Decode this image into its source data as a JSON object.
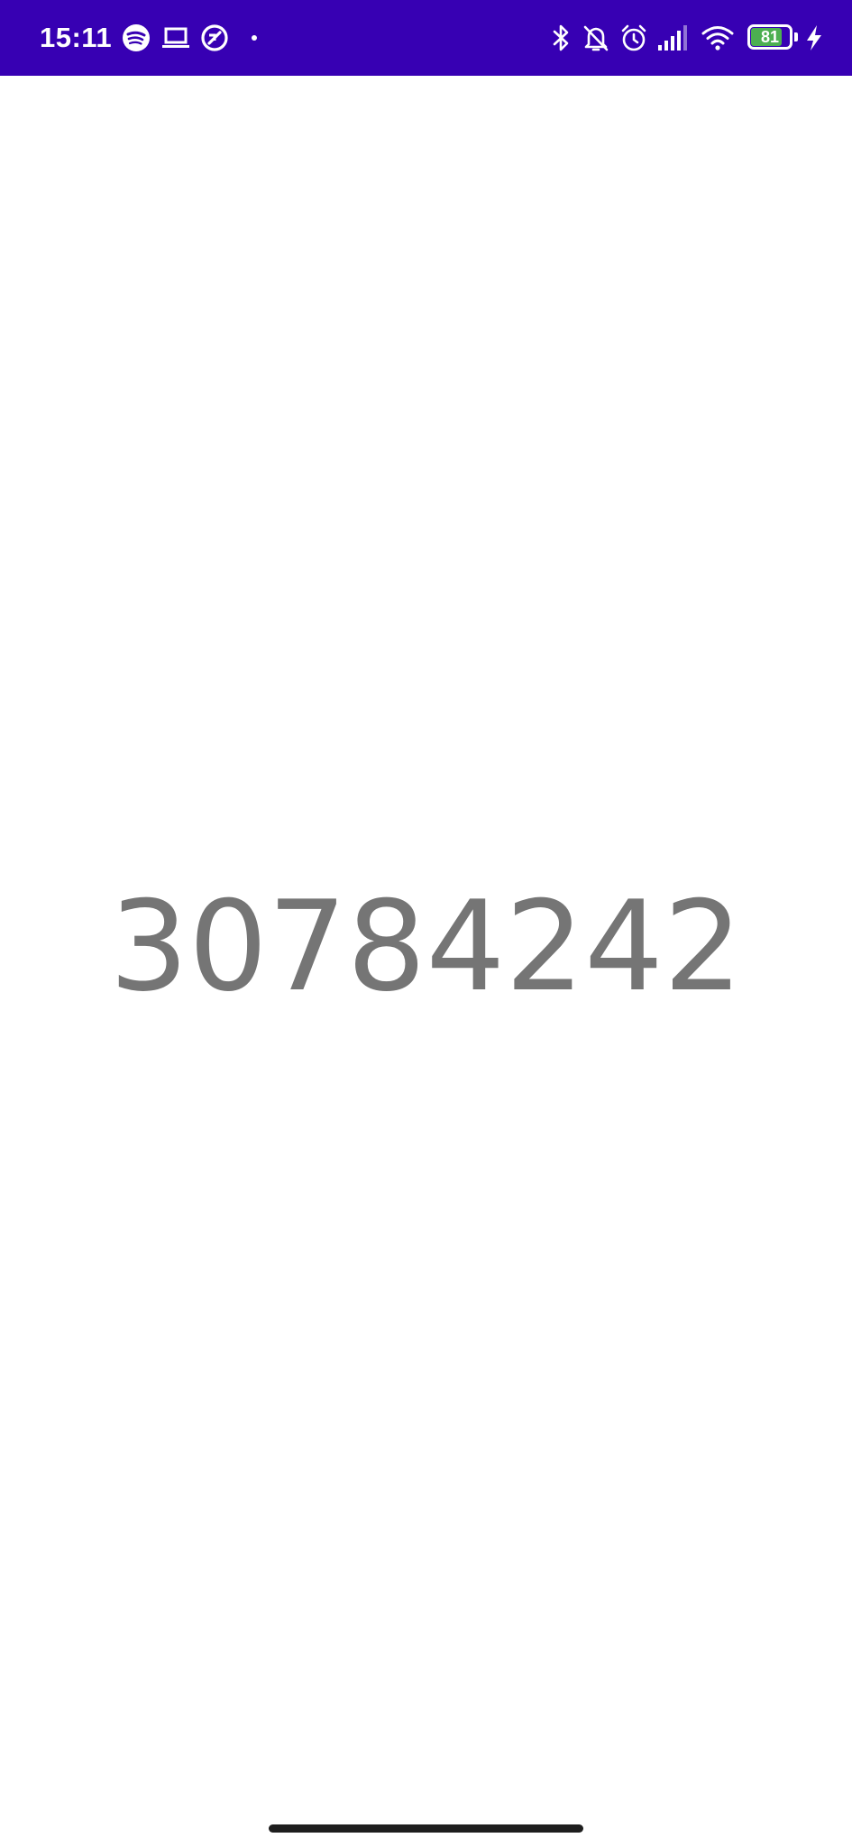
{
  "status_bar": {
    "time": "15:11",
    "background_color": "#3700b3",
    "left_icons": [
      "spotify-icon",
      "laptop-icon",
      "data-saver-icon",
      "dot-icon"
    ],
    "right_icons": [
      "bluetooth-icon",
      "notifications-off-icon",
      "alarm-icon",
      "signal-icon",
      "wifi-icon",
      "battery-icon",
      "charging-icon"
    ],
    "battery": {
      "level_text": "81",
      "level_fraction": 0.81,
      "fill_color": "#4caf50"
    }
  },
  "main": {
    "number": "30784242",
    "text_color": "#757575"
  }
}
